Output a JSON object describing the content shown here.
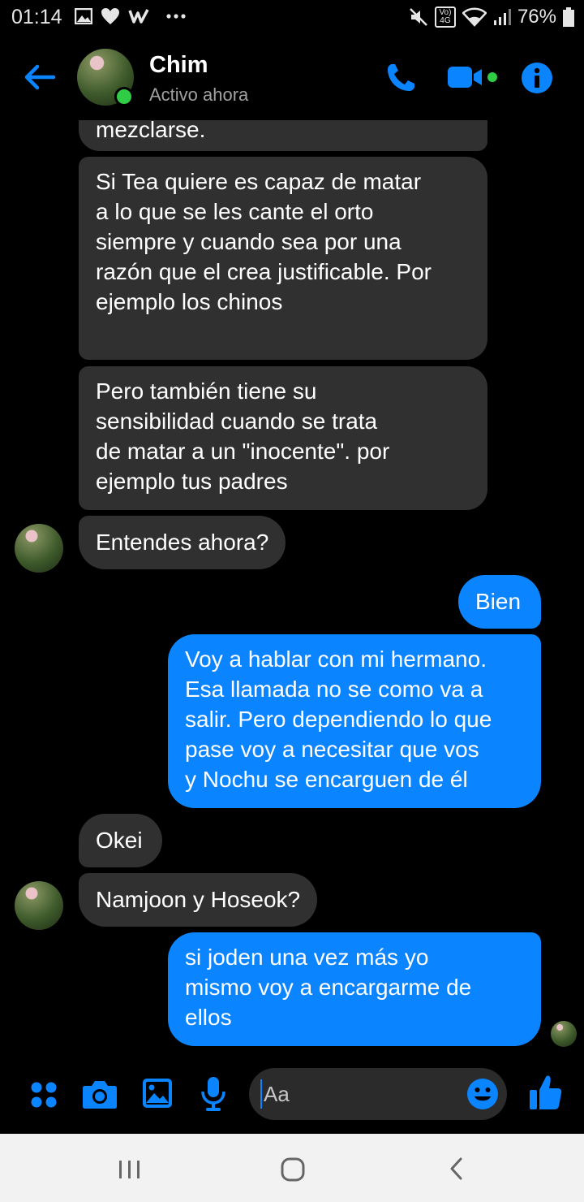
{
  "status_bar": {
    "time": "01:14",
    "battery": "76%",
    "network_label": "Vo) 4G",
    "icons": [
      "gallery-icon",
      "heart-icon",
      "w-icon",
      "more-icon",
      "mute-icon",
      "volte-icon",
      "wifi-icon",
      "signal-icon",
      "battery-icon"
    ]
  },
  "header": {
    "contact_name": "Chim",
    "contact_status": "Activo ahora",
    "icons": [
      "back-arrow-icon",
      "phone-icon",
      "video-icon",
      "info-icon"
    ]
  },
  "messages": [
    {
      "side": "in",
      "text": "mezclarse."
    },
    {
      "side": "in",
      "lines": [
        "Si Tea quiere es capaz de matar",
        "a lo que se les cante el orto",
        "siempre y cuando sea por una",
        "razón que el crea justificable. Por",
        "ejemplo los chinos"
      ]
    },
    {
      "side": "in",
      "lines": [
        "Pero también tiene su",
        "sensibilidad cuando se trata",
        "de matar a un \"inocente\". por",
        "ejemplo tus padres"
      ]
    },
    {
      "side": "in",
      "text": "Entendes ahora?"
    },
    {
      "side": "out",
      "text": "Bien"
    },
    {
      "side": "out",
      "lines": [
        "Voy a hablar con mi hermano.",
        "Esa llamada no se como va a",
        "salir. Pero dependiendo lo que",
        "pase voy a necesitar que vos",
        "y Nochu se encarguen de él"
      ]
    },
    {
      "side": "in",
      "text": "Okei"
    },
    {
      "side": "in",
      "text": "Namjoon y Hoseok?"
    },
    {
      "side": "out",
      "lines": [
        "si joden una vez más yo",
        "mismo voy a encargarme de",
        "ellos"
      ]
    }
  ],
  "composer": {
    "placeholder": "Aa",
    "icons": [
      "apps-icon",
      "camera-icon",
      "image-icon",
      "microphone-icon",
      "emoji-icon",
      "thumbs-up-icon"
    ]
  },
  "nav_bar": {
    "icons": [
      "recent-apps-icon",
      "home-icon",
      "back-icon"
    ]
  },
  "colors": {
    "accent": "#0a84ff",
    "incoming_bubble": "#303030",
    "background": "#000000",
    "online": "#31cc46"
  }
}
